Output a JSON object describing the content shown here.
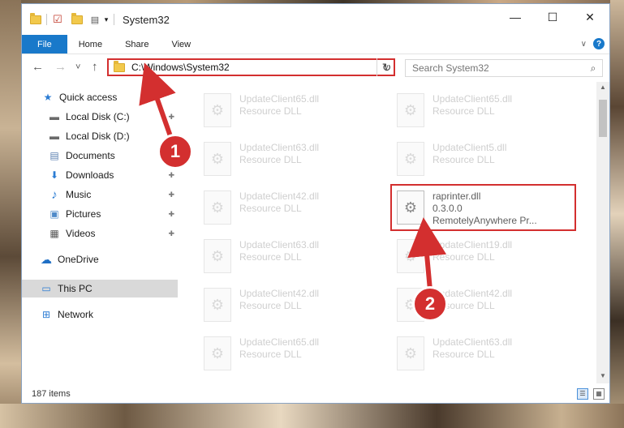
{
  "window": {
    "title": "System32",
    "controls": {
      "minimize": "—",
      "maximize": "☐",
      "close": "✕"
    }
  },
  "ribbon": {
    "tabs": [
      "File",
      "Home",
      "Share",
      "View"
    ],
    "help": "?"
  },
  "navbar": {
    "back": "←",
    "forward": "→",
    "recent": "˅",
    "up": "↑",
    "address": "C:\\Windows\\System32",
    "address_dropdown": "∨",
    "refresh": "↻",
    "search_placeholder": "Search System32",
    "search_icon": "⌕"
  },
  "sidebar": {
    "items": [
      {
        "label": "Quick access",
        "icon": "star-icon",
        "glyph": "★",
        "color": "#2b7cd3"
      },
      {
        "label": "Local Disk (C:)",
        "icon": "drive-icon",
        "glyph": "▬",
        "color": "#6a6a6a",
        "pinned": true
      },
      {
        "label": "Local Disk (D:)",
        "icon": "drive-icon",
        "glyph": "▬",
        "color": "#6a6a6a",
        "pinned": true
      },
      {
        "label": "Documents",
        "icon": "documents-icon",
        "glyph": "▤",
        "color": "#5a7fb0",
        "pinned": true
      },
      {
        "label": "Downloads",
        "icon": "downloads-icon",
        "glyph": "⬇",
        "color": "#2b7cd3",
        "pinned": true
      },
      {
        "label": "Music",
        "icon": "music-icon",
        "glyph": "♪",
        "color": "#2b7cd3",
        "pinned": true
      },
      {
        "label": "Pictures",
        "icon": "pictures-icon",
        "glyph": "▣",
        "color": "#4f8bc9",
        "pinned": true
      },
      {
        "label": "Videos",
        "icon": "videos-icon",
        "glyph": "▦",
        "color": "#555555",
        "pinned": true
      },
      {
        "label": "OneDrive",
        "icon": "onedrive-icon",
        "glyph": "☁",
        "color": "#1f6fc5"
      },
      {
        "label": "This PC",
        "icon": "computer-icon",
        "glyph": "▭",
        "color": "#2b7cd3",
        "selected": true
      },
      {
        "label": "Network",
        "icon": "network-icon",
        "glyph": "⊞",
        "color": "#2b7cd3"
      }
    ],
    "pin_glyph": "📌"
  },
  "files": {
    "left": [
      {
        "name": "UpdateClient65.dll",
        "type": "Resource DLL"
      },
      {
        "name": "UpdateClient63.dll",
        "type": "Resource DLL"
      },
      {
        "name": "UpdateClient42.dll",
        "type": "Resource DLL"
      },
      {
        "name": "UpdateClient63.dll",
        "type": "Resource DLL"
      },
      {
        "name": "UpdateClient42.dll",
        "type": "Resource DLL"
      },
      {
        "name": "UpdateClient65.dll",
        "type": "Resource DLL"
      }
    ],
    "right": [
      {
        "name": "UpdateClient65.dll",
        "type": "Resource DLL"
      },
      {
        "name": "UpdateClient5.dll",
        "type": "Resource DLL"
      },
      {
        "name": "raprinter.dll",
        "version": "0.3.0.0",
        "company": "RemotelyAnywhere Pr...",
        "highlight": true
      },
      {
        "name": "UpdateClient19.dll",
        "type": "Resource DLL"
      },
      {
        "name": "UpdateClient42.dll",
        "type": "Resource DLL"
      },
      {
        "name": "UpdateClient63.dll",
        "type": "Resource DLL"
      }
    ]
  },
  "status": {
    "item_count": "187 items"
  },
  "annotations": {
    "step1": "1",
    "step2": "2",
    "accent": "#d32f2f"
  }
}
